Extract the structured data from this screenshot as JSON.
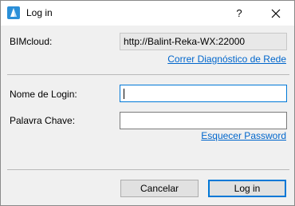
{
  "window": {
    "title": "Log in",
    "help_glyph": "?",
    "icons": {
      "app": "bimcloud-app-icon",
      "close": "close-icon"
    }
  },
  "server": {
    "label": "BIMcloud:",
    "value": "http://Balint-Reka-WX:22000",
    "diagnostics_link": "Correr Diagnóstico de Rede"
  },
  "login": {
    "username_label": "Nome de Login:",
    "username_value": "",
    "password_label": "Palavra Chave:",
    "password_value": "",
    "forgot_link": "Esquecer Password"
  },
  "buttons": {
    "cancel": "Cancelar",
    "login": "Log in"
  },
  "colors": {
    "link": "#0066cc",
    "focus_border": "#0078d7",
    "background": "#f0f0f0",
    "button_face": "#e1e1e1"
  }
}
